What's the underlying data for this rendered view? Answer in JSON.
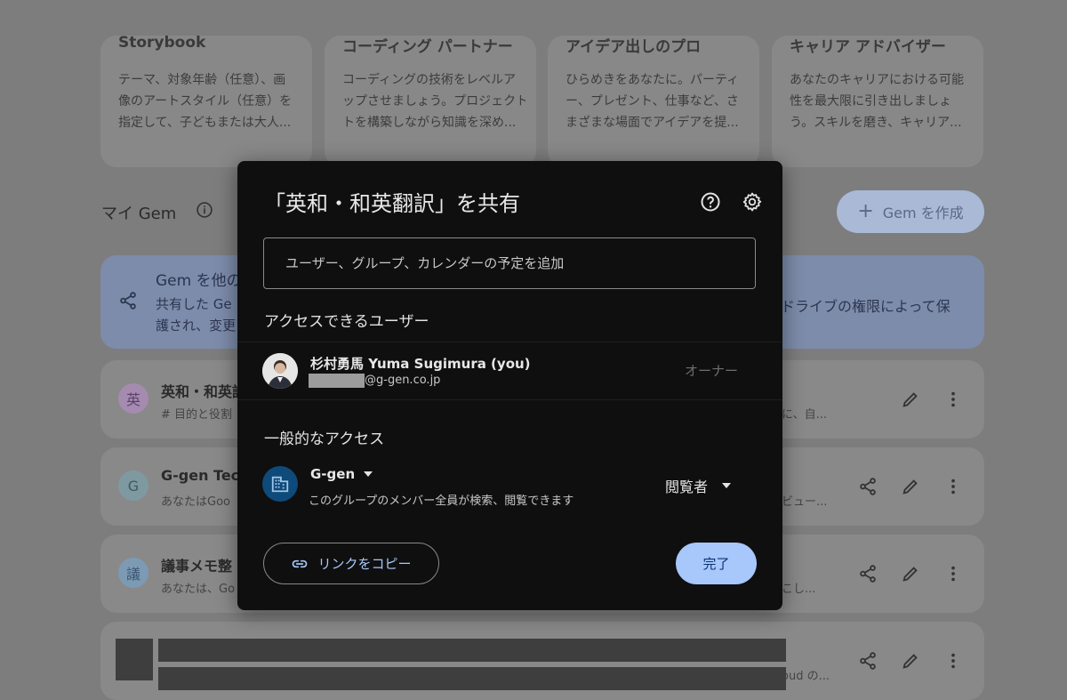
{
  "cards": [
    {
      "title": "Storybook",
      "desc": [
        "テーマ、対象年齢（任意）、画",
        "像のアートスタイル（任意）を",
        "指定して、子どもまたは大人..."
      ]
    },
    {
      "title": "コーディング パートナー",
      "desc": [
        "コーディングの技術をレベルア",
        "ップさせましょう。プロジェクト",
        "トを構築しながら知識を深め..."
      ]
    },
    {
      "title": "アイデア出しのプロ",
      "desc": [
        "ひらめきをあなたに。パーティ",
        "ー、プレゼント、仕事など、さ",
        "まざまな場面でアイデアを提..."
      ]
    },
    {
      "title": "キャリア アドバイザー",
      "desc": [
        "あなたのキャリアにおける可能",
        "性を最大限に引き出しましょ",
        "う。スキルを磨き、キャリア..."
      ]
    }
  ],
  "my_gem": {
    "title": "マイ Gem",
    "create_label": "Gem を作成"
  },
  "banner": {
    "title": "Gem を他の",
    "text1": "共有した Ge",
    "text2": "護され、変更",
    "right": "ドライブの権限によって保"
  },
  "rows": [
    {
      "avatar": "英",
      "title": "英和・和英訳",
      "desc": "# 目的と役割",
      "right": "に、自..."
    },
    {
      "avatar": "G",
      "title": "G-gen Tech",
      "desc": "あなたはGoo",
      "right": "ビュー..."
    },
    {
      "avatar": "議",
      "title": "議事メモ整",
      "desc": "あなたは、Go",
      "right": "こし..."
    },
    {
      "avatar": "",
      "title": "",
      "desc": "",
      "right": "oud の..."
    }
  ],
  "dialog": {
    "title": "「英和・和英翻訳」を共有",
    "input_placeholder": "ユーザー、グループ、カレンダーの予定を追加",
    "access_users_heading": "アクセスできるユーザー",
    "user": {
      "name": "杉村勇馬 Yuma Sugimura (you)",
      "email_domain": "@g-gen.co.jp",
      "role": "オーナー"
    },
    "general_access_heading": "一般的なアクセス",
    "group": {
      "name": "G-gen",
      "desc": "このグループのメンバー全員が検索、閲覧できます",
      "role": "閲覧者"
    },
    "copy_link_label": "リンクをコピー",
    "done_label": "完了"
  },
  "colors": {
    "accent": "#a8c7fa",
    "dialog_bg": "#0f0f0f",
    "overlay_bg": "#7d7d7d"
  }
}
